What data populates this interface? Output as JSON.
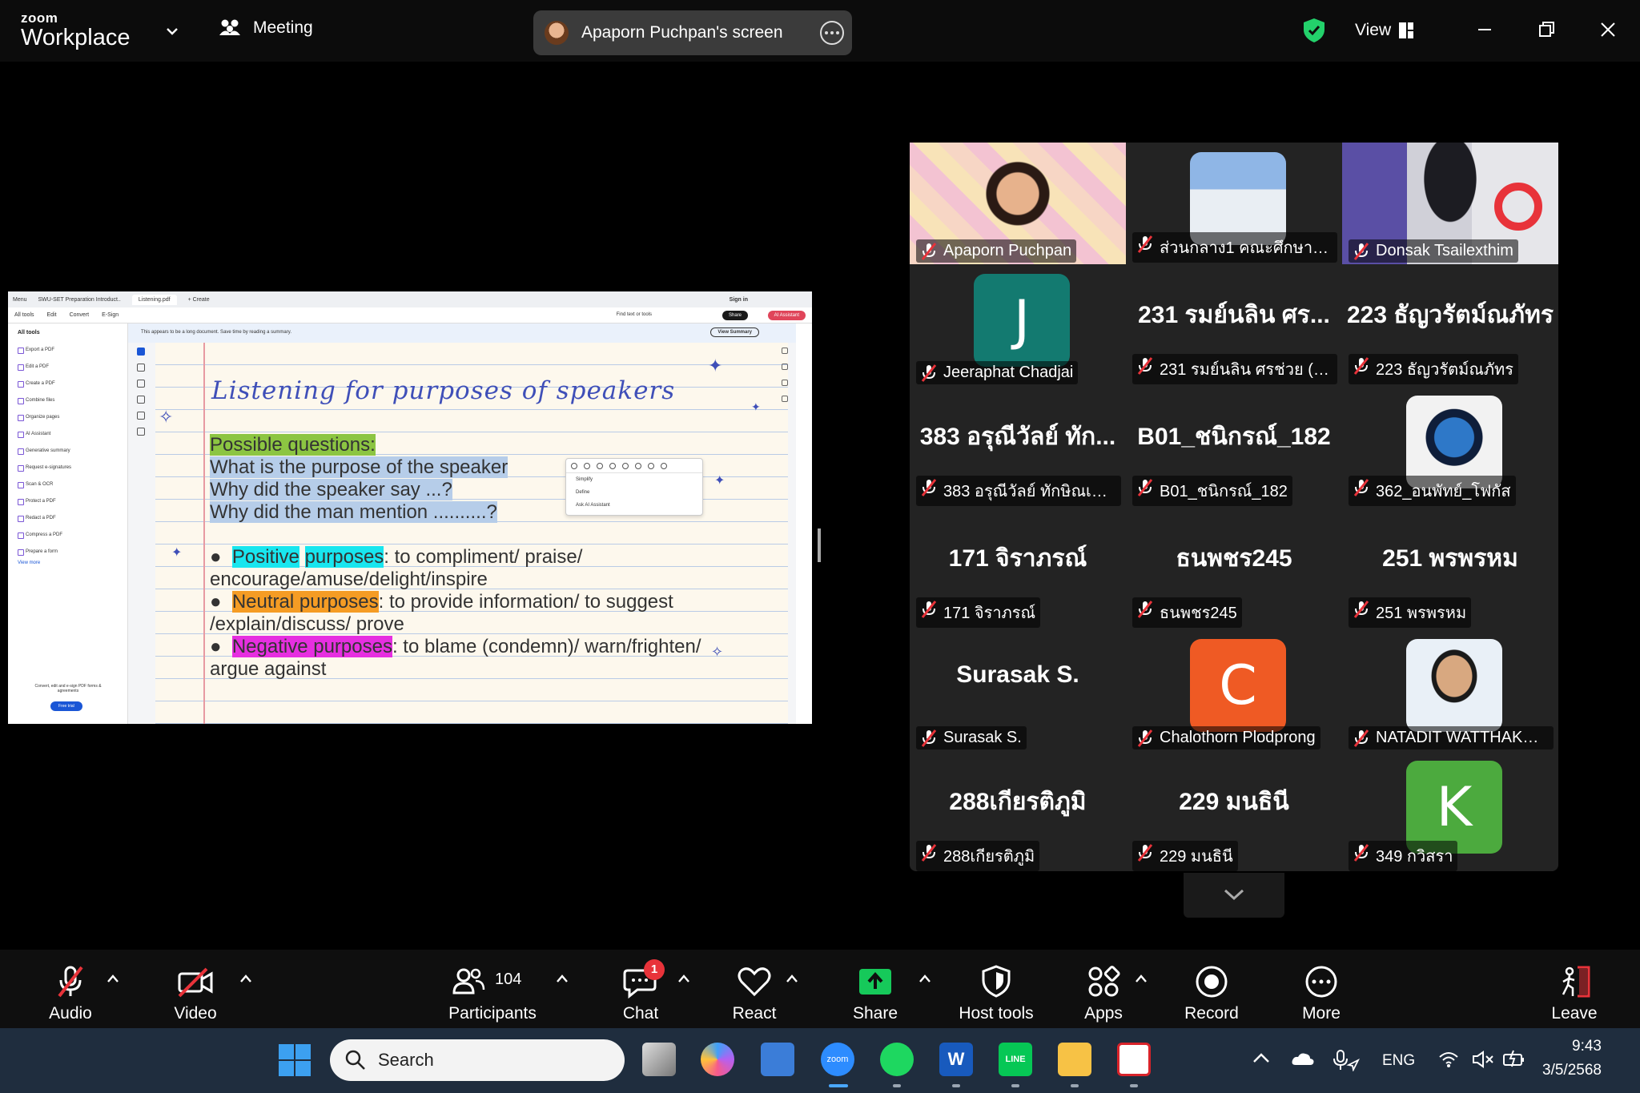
{
  "topbar": {
    "brand_small": "zoom",
    "brand_big": "Workplace",
    "meeting_label": "Meeting",
    "screen_label": "Apaporn Puchpan's screen",
    "view_label": "View"
  },
  "shared_screen": {
    "acrobat": {
      "tabs": [
        "Menu",
        "SWU-SET Preparation Introduct..",
        "Listening.pdf",
        "+ Create"
      ],
      "sign_in": "Sign in",
      "menu": [
        "All tools",
        "Edit",
        "Convert",
        "E-Sign"
      ],
      "find_placeholder": "Find text or tools",
      "share_label": "Share",
      "ai_label": "AI Assistant",
      "panel_title": "All tools",
      "tools": [
        "Export a PDF",
        "Edit a PDF",
        "Create a PDF",
        "Combine files",
        "Organize pages",
        "AI Assistant",
        "Generative summary",
        "Request e-signatures",
        "Scan & OCR",
        "Protect a PDF",
        "Redact a PDF",
        "Compress a PDF",
        "Prepare a form"
      ],
      "view_more": "View more",
      "footer": "Convert, edit and e-sign PDF forms & agreements",
      "trial": "Free trial",
      "banner": "This appears to be a long document. Save time by reading a summary.",
      "view_summary": "View Summary",
      "context_menu": [
        "Simplify",
        "Define",
        "Ask AI Assistant"
      ]
    },
    "slide": {
      "title": "Listening for purposes of speakers",
      "q_heading": "Possible questions:",
      "q1": "What is the purpose of the speaker",
      "q2": "Why did the speaker say ...?",
      "q3": "Why did the man mention ..........?",
      "p1_hl1": "Positive",
      "p1_hl2": "purposes",
      "p1_rest": ":  to compliment/ praise/",
      "p1_line2": "encourage/amuse/delight/inspire",
      "p2_hl": "Neutral purposes",
      "p2_rest": ": to provide information/ to suggest",
      "p2_line2": "/explain/discuss/ prove",
      "p3_hl": "Negative purposes",
      "p3_rest": ": to blame (condemn)/ warn/frighten/",
      "p3_line2": "argue against"
    }
  },
  "gallery": {
    "tiles": [
      {
        "name": "Apaporn Puchpan",
        "big": "",
        "type": "video"
      },
      {
        "name": "ส่วนกลาง1 คณะศึกษาศาส...",
        "big": "",
        "type": "photo"
      },
      {
        "name": "Donsak Tsailexthim",
        "big": "",
        "type": "video"
      },
      {
        "name": "Jeeraphat Chadjai",
        "big": "",
        "type": "avatar",
        "initial": "J",
        "color": "#137a70"
      },
      {
        "name": "231 รมย์นลิน ศรช่วย (ฟ้า)",
        "big": "231 รมย์นลิน ศร...",
        "type": "text"
      },
      {
        "name": "223 ธัญวรัตม์ณภัทร",
        "big": "223 ธัญวรัตม์ณภัทร",
        "type": "text"
      },
      {
        "name": "383 อรุณีวัลย์ ทักษิณเจนกิจ",
        "big": "383 อรุณีวัลย์ ทัก...",
        "type": "text"
      },
      {
        "name": "B01_ชนิกรณ์_182",
        "big": "B01_ชนิกรณ์_182",
        "type": "text"
      },
      {
        "name": "362_อนพัทย์_โฟกัส",
        "big": "",
        "type": "photo"
      },
      {
        "name": "171 จิราภรณ์",
        "big": "171 จิราภรณ์",
        "type": "text"
      },
      {
        "name": "ธนพชร245",
        "big": "ธนพชร245",
        "type": "text"
      },
      {
        "name": "251 พรพรหม",
        "big": "251 พรพรหม",
        "type": "text"
      },
      {
        "name": "Surasak S.",
        "big": "Surasak S.",
        "type": "text"
      },
      {
        "name": "Chalothorn Plodprong",
        "big": "",
        "type": "avatar",
        "initial": "C",
        "color": "#ef5a24"
      },
      {
        "name": "NATADIT WATTHAKAN...",
        "big": "",
        "type": "photo"
      },
      {
        "name": "288เกียรติภูมิ",
        "big": "288เกียรติภูมิ",
        "type": "text"
      },
      {
        "name": "229 มนธินี",
        "big": "229 มนธินี",
        "type": "text"
      },
      {
        "name": "349 กวิสรา",
        "big": "",
        "type": "avatar",
        "initial": "K",
        "color": "#4caa3e"
      }
    ]
  },
  "toolbar": {
    "audio": "Audio",
    "video": "Video",
    "participants": "Participants",
    "participant_count": "104",
    "chat": "Chat",
    "chat_badge": "1",
    "react": "React",
    "share": "Share",
    "host_tools": "Host tools",
    "apps": "Apps",
    "record": "Record",
    "more": "More",
    "leave": "Leave"
  },
  "taskbar": {
    "search": "Search",
    "lang": "ENG",
    "time": "9:43",
    "date": "3/5/2568"
  },
  "colors": {
    "zoom_green": "#23d16b",
    "share_green": "#16c95a",
    "muted_red": "#e8333a"
  }
}
